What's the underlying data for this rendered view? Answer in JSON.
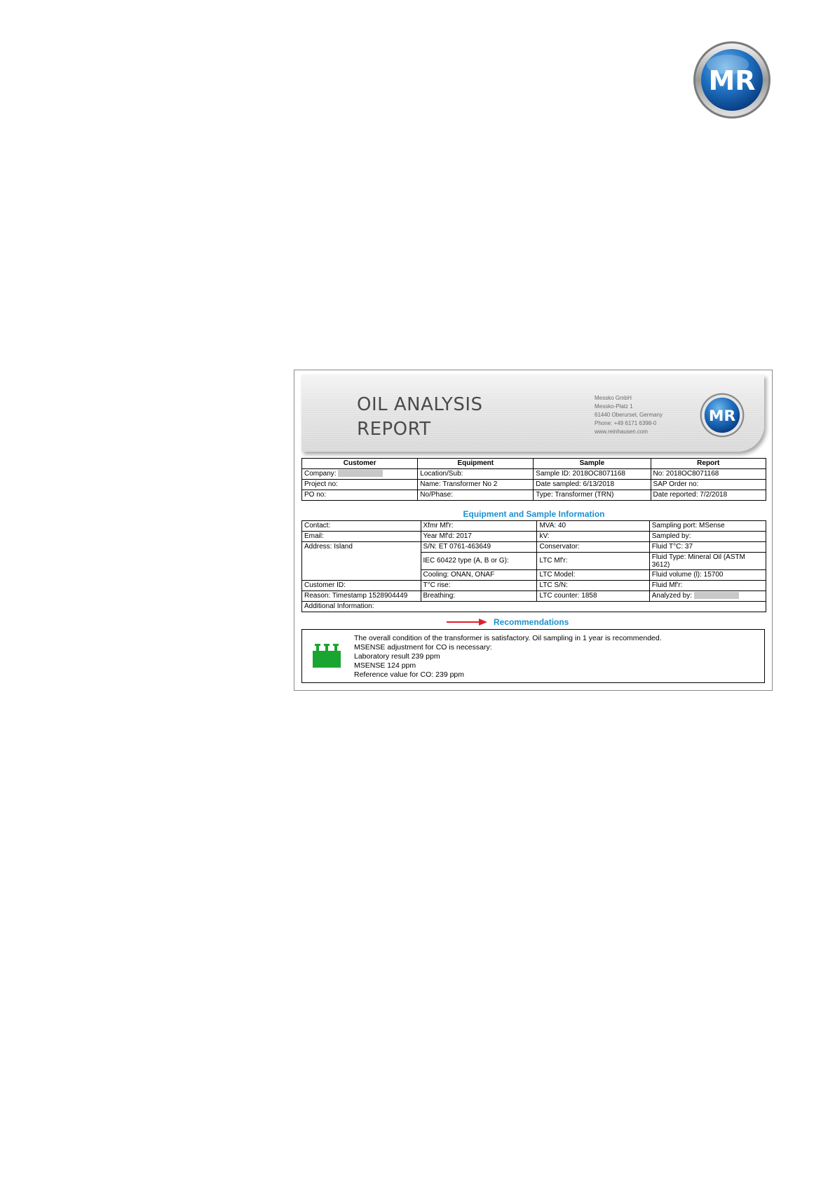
{
  "brand": {
    "logo_text": "MR"
  },
  "report": {
    "banner": {
      "title_line1": "OIL ANALYSIS",
      "title_line2": "REPORT",
      "company_lines": [
        "Messko GmbH",
        "Messko-Platz 1",
        "61440 Oberursel, Germany",
        "Phone: +49 6171 6398-0",
        "www.reinhausen.com"
      ],
      "logo_text": "MR"
    },
    "header_table": {
      "columns": [
        "Customer",
        "Equipment",
        "Sample",
        "Report"
      ],
      "rows": [
        [
          "Company:",
          "Location/Sub:",
          "Sample ID: 2018OC8071168",
          "No: 2018OC8071168"
        ],
        [
          "Project no:",
          "Name: Transformer No 2",
          "Date sampled: 6/13/2018",
          "SAP Order no:"
        ],
        [
          "PO no:",
          "No/Phase:",
          "Type: Transformer (TRN)",
          "Date reported: 7/2/2018"
        ]
      ]
    },
    "equipment_section_title": "Equipment and Sample Information",
    "equipment_table": {
      "contact": "Contact:",
      "email": "Email:",
      "address": "Address: Island",
      "customer_id": "Customer ID:",
      "reason": "Reason: Timestamp 1528904449",
      "additional": "Additional Information:",
      "col2": [
        "Xfmr Mf'r:",
        "Year Mf'd: 2017",
        "S/N: ET 0761-463649",
        "IEC 60422 type (A, B or G):",
        "Cooling: ONAN, ONAF",
        "T°C rise:",
        "Breathing:"
      ],
      "col3": [
        "MVA: 40",
        "kV:",
        "Conservator:",
        "LTC Mf'r:",
        "LTC Model:",
        "LTC S/N:",
        "LTC counter: 1858"
      ],
      "col4": [
        "Sampling port: MSense",
        "Sampled by:",
        "Fluid T°C: 37",
        "Fluid Type: Mineral Oil  (ASTM 3612)",
        "Fluid volume (l): 15700",
        "Fluid Mf'r:",
        "Analyzed by:"
      ]
    },
    "recommendations": {
      "title": "Recommendations",
      "status_color": "#1aa531",
      "lines": [
        "The overall condition of the transformer is satisfactory. Oil sampling in 1 year is recommended.",
        "MSENSE adjustment for CO is necessary:",
        "Laboratory result 239 ppm",
        "MSENSE 124 ppm",
        "Reference value for CO: 239 ppm"
      ]
    }
  }
}
